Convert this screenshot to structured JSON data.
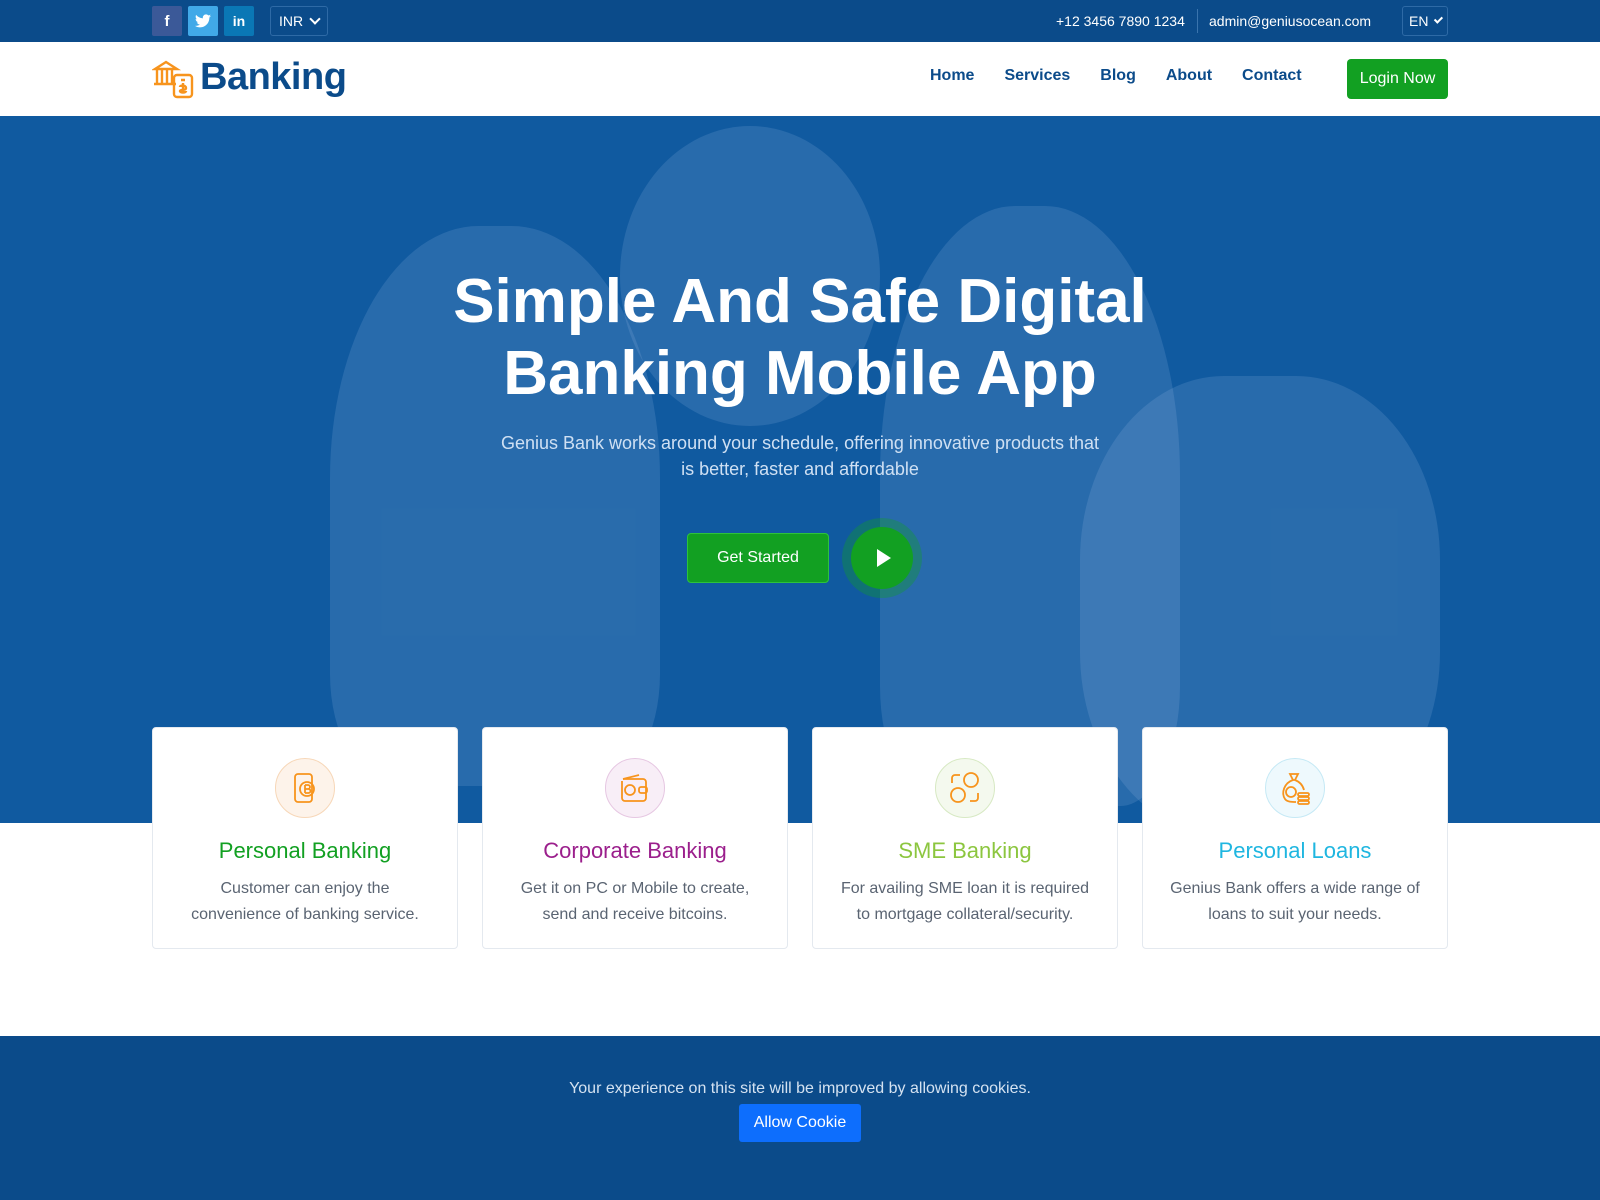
{
  "topbar": {
    "social": [
      {
        "name": "facebook",
        "glyph": "f"
      },
      {
        "name": "twitter",
        "glyph": "t"
      },
      {
        "name": "linkedin",
        "glyph": "in"
      }
    ],
    "currency": "INR",
    "phone": "+12 3456 7890 1234",
    "email": "admin@geniusocean.com",
    "language": "EN"
  },
  "header": {
    "logo_text": "Banking",
    "nav": [
      "Home",
      "Services",
      "Blog",
      "About",
      "Contact"
    ],
    "login_label": "Login Now"
  },
  "hero": {
    "title_line1": "Simple And Safe Digital",
    "title_line2": "Banking Mobile App",
    "subtitle": "Genius Bank works around your schedule, offering innovative products that is better, faster and affordable",
    "cta_label": "Get Started"
  },
  "cards": [
    {
      "title": "Personal Banking",
      "text": "Customer can enjoy the convenience of banking service.",
      "color": "#12a022",
      "icon": "mobile-bitcoin-icon",
      "ring": "#fbe9d8"
    },
    {
      "title": "Corporate Banking",
      "text": "Get it on PC or Mobile to create, send and receive bitcoins.",
      "color": "#9b1f8c",
      "icon": "wallet-bitcoin-icon",
      "ring": "#f3e1f1"
    },
    {
      "title": "SME Banking",
      "text": "For availing SME loan it is required to mortgage collateral/security.",
      "color": "#8cc63f",
      "icon": "exchange-coins-icon",
      "ring": "#e9f3df"
    },
    {
      "title": "Personal Loans",
      "text": "Genius Bank offers a wide range of loans to suit your needs.",
      "color": "#1fb6e0",
      "icon": "money-bag-icon",
      "ring": "#dcf3fa"
    }
  ],
  "cookie": {
    "text": "Your experience on this site will be improved by allowing cookies.",
    "button_label": "Allow Cookie"
  },
  "colors": {
    "primary": "#0b4b8a",
    "accent": "#12a022",
    "icon_orange": "#f7941d"
  }
}
